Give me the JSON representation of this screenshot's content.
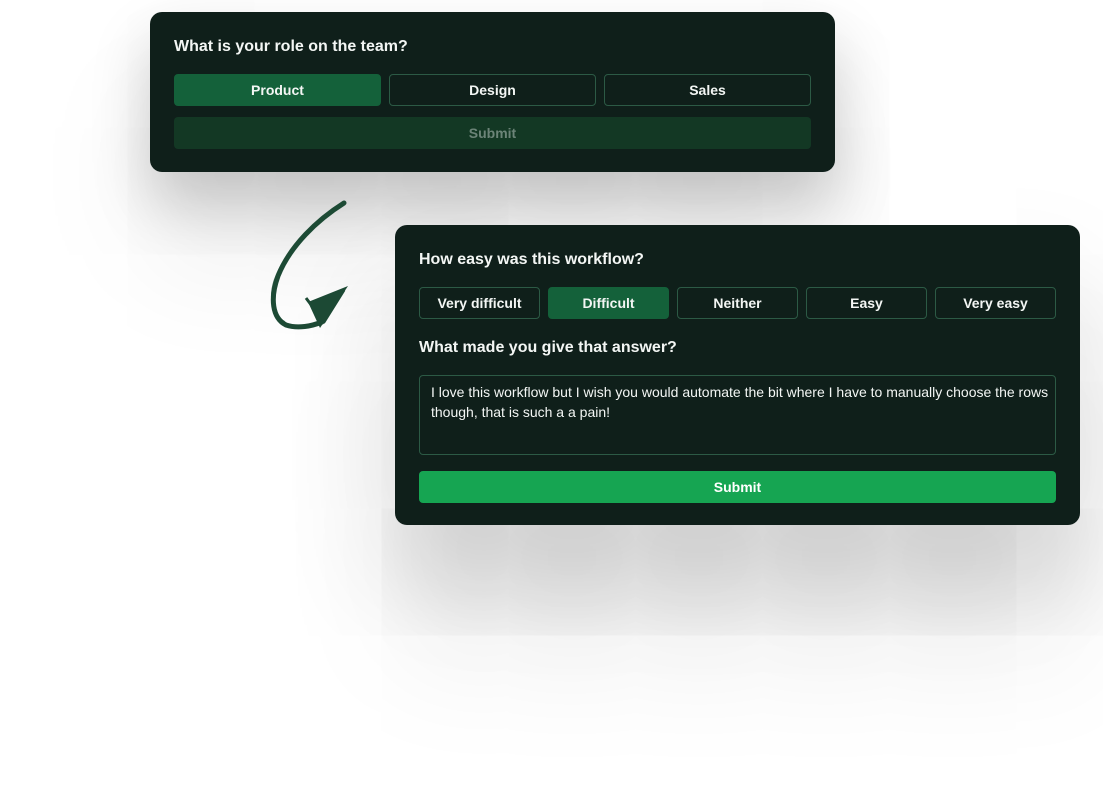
{
  "role_card": {
    "question": "What is your role on the team?",
    "options": [
      "Product",
      "Design",
      "Sales"
    ],
    "selected": "Product",
    "submit_label": "Submit"
  },
  "workflow_card": {
    "question": "How easy was this workflow?",
    "options": [
      "Very difficult",
      "Difficult",
      "Neither",
      "Easy",
      "Very easy"
    ],
    "selected": "Difficult",
    "followup_question": "What made you give that answer?",
    "answer_text": "I love this workflow but I wish you would automate the bit where I have to manually choose the rows though, that is such a a pain!",
    "submit_label": "Submit"
  },
  "icons": {
    "arrow": "hand-drawn-curved-arrow-icon"
  },
  "colors": {
    "card_background": "#0f1f1a",
    "selected_option": "#14613a",
    "submit_active": "#16a552",
    "submit_disabled": "#133824",
    "option_border": "#2c5a45",
    "arrow": "#1d4a35"
  }
}
